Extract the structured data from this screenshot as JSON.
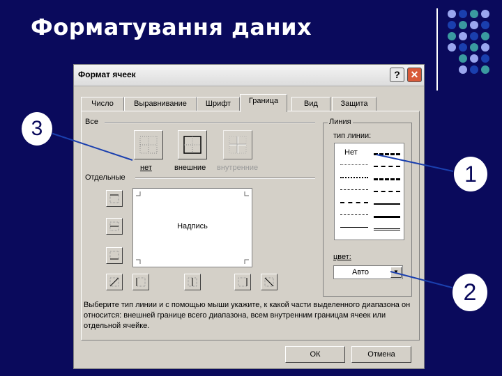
{
  "slide": {
    "title": "Форматування даних",
    "accent_color": "#0a0a5c",
    "dot_colors": [
      "#9aa6ee",
      "#1a3fae",
      "#3a9aa0"
    ]
  },
  "dialog": {
    "title": "Формат ячеек",
    "help_label": "?",
    "close_label": "✕",
    "tabs": [
      {
        "label": "Число"
      },
      {
        "label": "Выравнивание"
      },
      {
        "label": "Шрифт"
      },
      {
        "label": "Граница"
      },
      {
        "label": "Вид"
      },
      {
        "label": "Защита"
      }
    ],
    "active_tab": "Граница",
    "presets": {
      "section_label": "Все",
      "none_label": "нет",
      "outline_label": "внешние",
      "inside_label": "внутренние"
    },
    "border_section_label": "Отдельные",
    "preview_text": "Надпись",
    "line": {
      "group_label": "Линия",
      "style_label": "тип линии:",
      "none_style_label": "Нет",
      "color_label": "цвет:",
      "color_value": "Авто"
    },
    "description": "Выберите тип линии и с помощью мыши укажите, к какой части выделенного диапазона он относится: внешней границе всего диапазона, всем внутренним границам ячеек или отдельной ячейке.",
    "ok_label": "ОК",
    "cancel_label": "Отмена"
  },
  "callouts": [
    {
      "label": "3"
    },
    {
      "label": "1"
    },
    {
      "label": "2"
    }
  ]
}
